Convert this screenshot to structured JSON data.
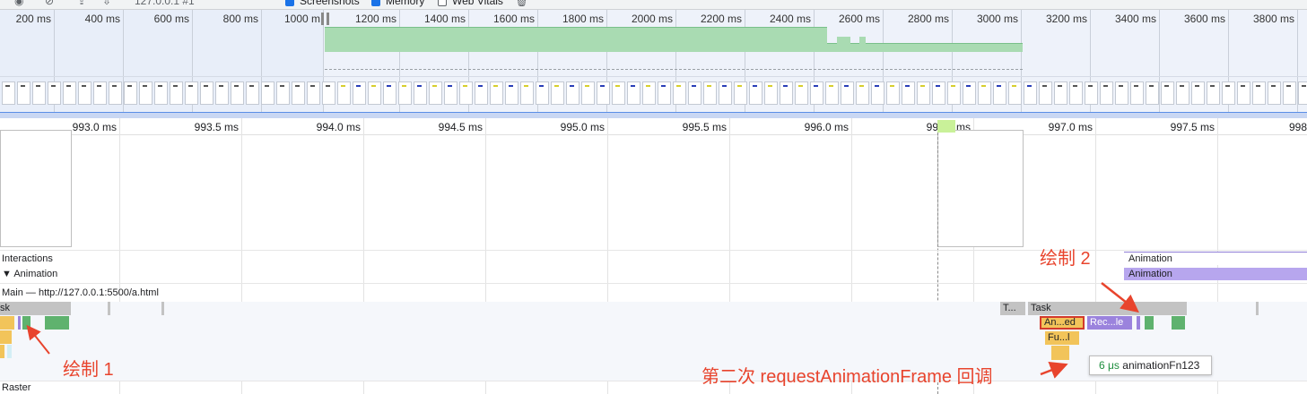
{
  "toolbar": {
    "url": "127.0.0.1 #1",
    "screenshots_label": "Screenshots",
    "memory_label": "Memory",
    "webvitals_label": "Web Vitals"
  },
  "overview": {
    "ticks": [
      "200 ms",
      "400 ms",
      "600 ms",
      "800 ms",
      "1000 m",
      "1200 ms",
      "1400 ms",
      "1600 ms",
      "1800 ms",
      "2000 ms",
      "2200 ms",
      "2400 ms",
      "2600 ms",
      "2800 ms",
      "3000 ms",
      "3200 ms",
      "3400 ms",
      "3600 ms",
      "3800 ms"
    ]
  },
  "ruler": {
    "ticks": [
      "993.0 ms",
      "993.5 ms",
      "994.0 ms",
      "994.5 ms",
      "995.0 ms",
      "995.5 ms",
      "996.0 ms",
      "996.5 ms",
      "997.0 ms",
      "997.5 ms",
      "998"
    ]
  },
  "tracks": {
    "interactions": "Interactions",
    "animation": "Animation",
    "animation_toggle": "▼",
    "main": "Main — http://127.0.0.1:5500/a.html",
    "raster": "Raster"
  },
  "animation_bars": {
    "a1": "Animation",
    "a2": "Animation"
  },
  "events": {
    "task_left": "sk",
    "task_t": "T...",
    "task": "Task",
    "an_ed": "An...ed",
    "rec_le": "Rec...le",
    "fu_l": "Fu...l"
  },
  "annotations": {
    "draw1": "绘制 1",
    "draw2": "绘制 2",
    "second_raf": "第二次 requestAnimationFrame 回调"
  },
  "tooltip": {
    "duration": "6 μs",
    "name": "animationFn123"
  },
  "colors": {
    "task": "#c3c3c3",
    "scripting": "#f2c45a",
    "painting": "#5fb26e",
    "rendering": "#9b83dd",
    "annotation": "#e8442d",
    "highlight": "#d33a2c"
  }
}
